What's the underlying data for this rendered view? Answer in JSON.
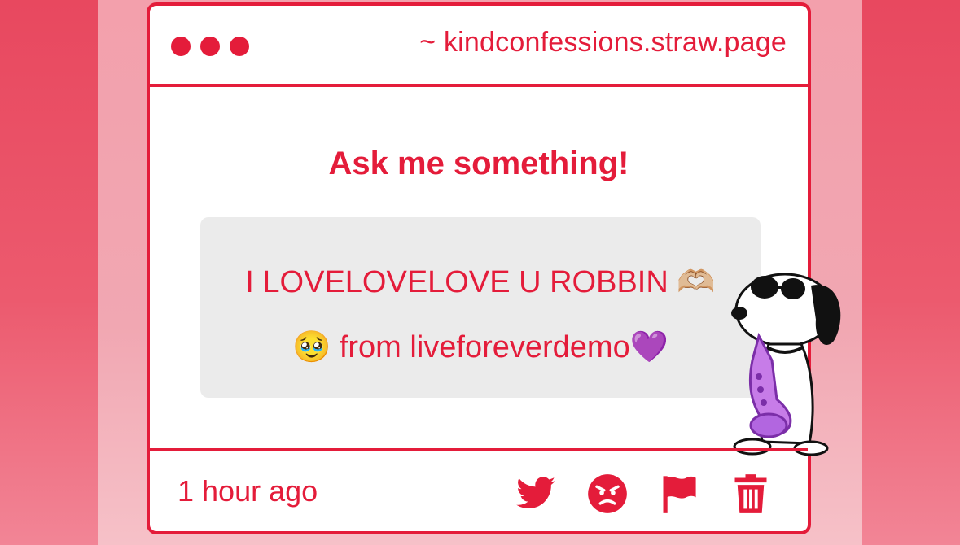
{
  "window": {
    "url_text": "~ kindconfessions.straw.page"
  },
  "main": {
    "prompt": "Ask me something!",
    "message_line1": "I LOVELOVELOVE U ROBBIN 🫶🏼",
    "message_line2": "🥹 from liveforeverdemo💜"
  },
  "footer": {
    "timestamp": "1 hour ago",
    "actions": [
      {
        "name": "twitter-icon"
      },
      {
        "name": "angry-face-icon"
      },
      {
        "name": "flag-icon"
      },
      {
        "name": "trash-icon"
      }
    ]
  },
  "colors": {
    "accent": "#e41c3a",
    "page_bg": "#e8485f",
    "panel_bg": "#f3a0ac",
    "message_bg": "#ebebeb"
  },
  "sticker": {
    "name": "snoopy-saxophone-sticker"
  }
}
